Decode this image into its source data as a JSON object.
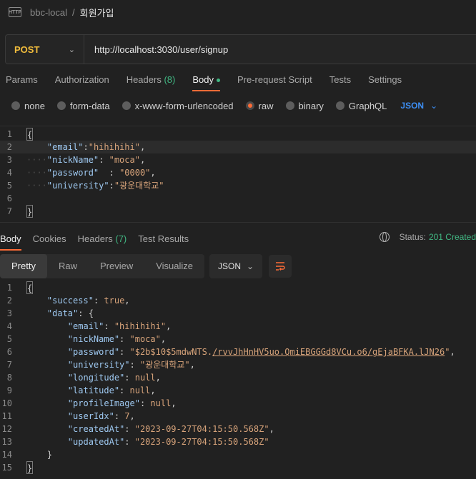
{
  "breadcrumb": {
    "icon_text": "HTTP",
    "collection": "bbc-local",
    "separator": "/",
    "request": "회원가입"
  },
  "request": {
    "method": "POST",
    "url": "http://localhost:3030/user/signup"
  },
  "req_tabs": [
    {
      "label": "Params"
    },
    {
      "label": "Authorization"
    },
    {
      "label": "Headers",
      "count": "(8)"
    },
    {
      "label": "Body"
    },
    {
      "label": "Pre-request Script"
    },
    {
      "label": "Tests"
    },
    {
      "label": "Settings"
    }
  ],
  "body_types": [
    "none",
    "form-data",
    "x-www-form-urlencoded",
    "raw",
    "binary",
    "GraphQL"
  ],
  "body_lang": "JSON",
  "request_body": {
    "line_numbers": [
      "1",
      "2",
      "3",
      "4",
      "5",
      "6",
      "7"
    ],
    "email_key": "\"email\"",
    "email_val": "\"hihihihi\"",
    "nick_key": "\"nickName\"",
    "nick_val": "\"moca\"",
    "pw_key": "\"password\"",
    "pw_val": "\"0000\"",
    "uni_key": "\"university\"",
    "uni_val": "\"광운대학교\""
  },
  "resp_tabs": [
    {
      "label": "Body"
    },
    {
      "label": "Cookies"
    },
    {
      "label": "Headers",
      "count": "(7)"
    },
    {
      "label": "Test Results"
    }
  ],
  "status": {
    "label": "Status:",
    "value": "201 Created"
  },
  "view_modes": [
    "Pretty",
    "Raw",
    "Preview",
    "Visualize"
  ],
  "resp_format": "JSON",
  "response": {
    "line_numbers": [
      "1",
      "2",
      "3",
      "4",
      "5",
      "6",
      "7",
      "8",
      "9",
      "10",
      "11",
      "12",
      "13",
      "14",
      "15"
    ],
    "success": "true",
    "email": "\"hihihihi\"",
    "nickName": "\"moca\"",
    "password_prefix": "\"$2b$10$5mdwNTS.",
    "password_link": "/rvvJhHnHV5uo.QmiEBGGGd8VCu.o6/gEjaBFKA.lJN26",
    "password_suffix": "\"",
    "university": "\"광운대학교\"",
    "longitude": "null",
    "latitude": "null",
    "profileImage": "null",
    "userIdx": "7",
    "createdAt": "\"2023-09-27T04:15:50.568Z\"",
    "updatedAt": "\"2023-09-27T04:15:50.568Z\""
  }
}
